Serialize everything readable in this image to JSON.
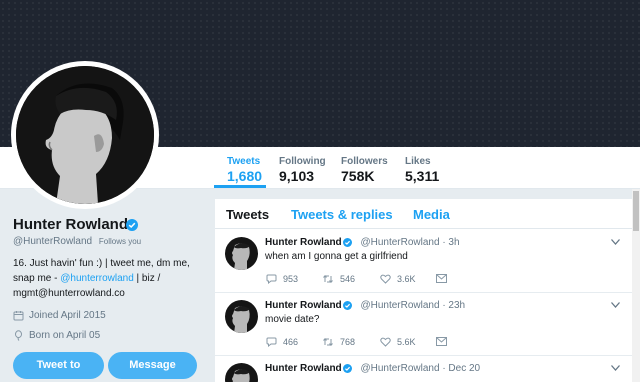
{
  "profile": {
    "name": "Hunter Rowland",
    "handle": "@HunterRowland",
    "follows_you": "Follows you",
    "bio_line1": "16. Just havin' fun :) | tweet me, dm me,",
    "bio_line2_prefix": "snap me - ",
    "bio_link": "@hunterrowland",
    "bio_line2_suffix": " | biz /",
    "bio_line3": "mgmt@hunterrowland.co",
    "joined": "Joined April 2015",
    "born": "Born on April 05"
  },
  "buttons": {
    "tweet_to": "Tweet to",
    "message": "Message"
  },
  "stats": [
    {
      "label": "Tweets",
      "value": "1,680"
    },
    {
      "label": "Following",
      "value": "9,103"
    },
    {
      "label": "Followers",
      "value": "758K"
    },
    {
      "label": "Likes",
      "value": "5,311"
    }
  ],
  "tabs": [
    "Tweets",
    "Tweets & replies",
    "Media"
  ],
  "tweets": [
    {
      "name": "Hunter Rowland",
      "handle": "@HunterRowland",
      "time": "· 3h",
      "text": "when am I gonna get a girlfriend",
      "replies": "953",
      "retweets": "546",
      "likes": "3.6K"
    },
    {
      "name": "Hunter Rowland",
      "handle": "@HunterRowland",
      "time": "· 23h",
      "text": "movie date?",
      "replies": "466",
      "retweets": "768",
      "likes": "5.6K"
    },
    {
      "name": "Hunter Rowland",
      "handle": "@HunterRowland",
      "time": "· Dec 20",
      "text": ""
    }
  ],
  "colors": {
    "accent": "#1da1f2",
    "button": "#4ab3f4",
    "banner": "#1f2530",
    "background": "#e6ecf0"
  }
}
